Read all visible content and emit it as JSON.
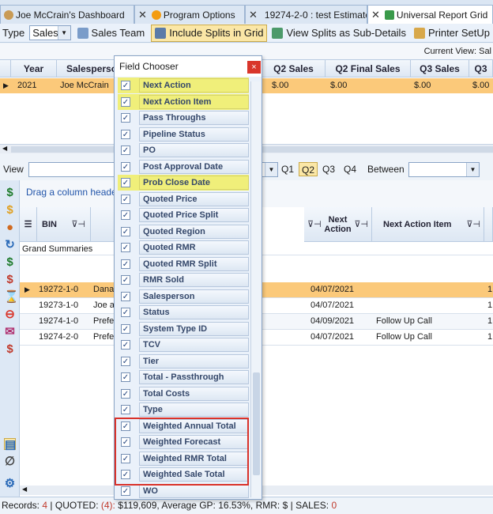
{
  "tabs": [
    {
      "label": "Joe McCrain's Dashboard",
      "close": "✕"
    },
    {
      "label": "Program Options",
      "close": "✕"
    },
    {
      "label": "19274-2-0 : test Estimate",
      "close": "✕"
    },
    {
      "label": "Universal Report Grid",
      "close": "✕"
    }
  ],
  "toolbar": {
    "type_label": "Type",
    "type_value": "Sales",
    "sales_team": "Sales Team",
    "include_splits": "Include Splits in Grid",
    "view_splits": "View Splits as Sub-Details",
    "printer_setup": "Printer SetUp"
  },
  "current_view": "Current View: Sal",
  "top_grid": {
    "headers": [
      "Year",
      "Salesperson",
      "Q2 Sales",
      "Q2 Final Sales",
      "Q3 Sales",
      "Q3"
    ],
    "row": [
      "2021",
      "Joe McCrain",
      "$.00",
      "$.00",
      "$.00",
      "$.00"
    ]
  },
  "view_bar": {
    "view_label": "View",
    "quarters": [
      "Q1",
      "Q2",
      "Q3",
      "Q4"
    ],
    "selected_quarter": "Q2",
    "between_label": "Between"
  },
  "main_grid": {
    "drag_hint": "Drag a column heade",
    "headers": {
      "bin": "BIN",
      "next_action": "Next Action",
      "next_action_item": "Next Action Item"
    },
    "grand_summaries": "Grand Summaries",
    "rows": [
      {
        "bin": "19272-1-0",
        "name": "Dana",
        "date": "04/07/2021",
        "item": "",
        "end": "1"
      },
      {
        "bin": "19273-1-0",
        "name": "Joe a",
        "date": "04/07/2021",
        "item": "",
        "end": "1"
      },
      {
        "bin": "19274-1-0",
        "name": "Prefe",
        "date": "04/09/2021",
        "item": "Follow Up Call",
        "end": "1"
      },
      {
        "bin": "19274-2-0",
        "name": "Prefe",
        "date": "04/07/2021",
        "item": "Follow Up Call",
        "end": "1"
      }
    ]
  },
  "status": {
    "records_label": "Records:",
    "records_value": "4",
    "quoted_label": "QUOTED:",
    "quoted_count": "(4):",
    "quoted_text": "$119,609, Average GP: 16.53%, RMR: $",
    "sales_label": "SALES:",
    "sales_value": "0"
  },
  "field_chooser": {
    "title": "Field Chooser",
    "close": "×",
    "check": "✓",
    "fields": [
      {
        "label": "Next Action",
        "highlight": true
      },
      {
        "label": "Next Action Item",
        "highlight": true
      },
      {
        "label": "Pass Throughs",
        "highlight": false
      },
      {
        "label": "Pipeline Status",
        "highlight": false
      },
      {
        "label": "PO",
        "highlight": false
      },
      {
        "label": "Post Approval Date",
        "highlight": false
      },
      {
        "label": "Prob Close Date",
        "highlight": true
      },
      {
        "label": "Quoted Price",
        "highlight": false
      },
      {
        "label": "Quoted Price Split",
        "highlight": false
      },
      {
        "label": "Quoted Region",
        "highlight": false
      },
      {
        "label": "Quoted RMR",
        "highlight": false
      },
      {
        "label": "Quoted RMR Split",
        "highlight": false
      },
      {
        "label": "RMR Sold",
        "highlight": false
      },
      {
        "label": "Salesperson",
        "highlight": false
      },
      {
        "label": "Status",
        "highlight": false
      },
      {
        "label": "System Type ID",
        "highlight": false
      },
      {
        "label": "TCV",
        "highlight": false
      },
      {
        "label": "Tier",
        "highlight": false
      },
      {
        "label": "Total - Passthrough",
        "highlight": false
      },
      {
        "label": "Total Costs",
        "highlight": false
      },
      {
        "label": "Type",
        "highlight": false
      },
      {
        "label": "Weighted Annual Total",
        "highlight": false
      },
      {
        "label": "Weighted Forecast",
        "highlight": false
      },
      {
        "label": "Weighted RMR Total",
        "highlight": false
      },
      {
        "label": "Weighted Sale Total",
        "highlight": false
      },
      {
        "label": "WO",
        "highlight": false
      }
    ]
  },
  "colors": {
    "selected_row": "#fbc97a",
    "highlight_field": "#f0ef7a",
    "callout_border": "#d9322a",
    "accent_blue": "#2255aa"
  }
}
